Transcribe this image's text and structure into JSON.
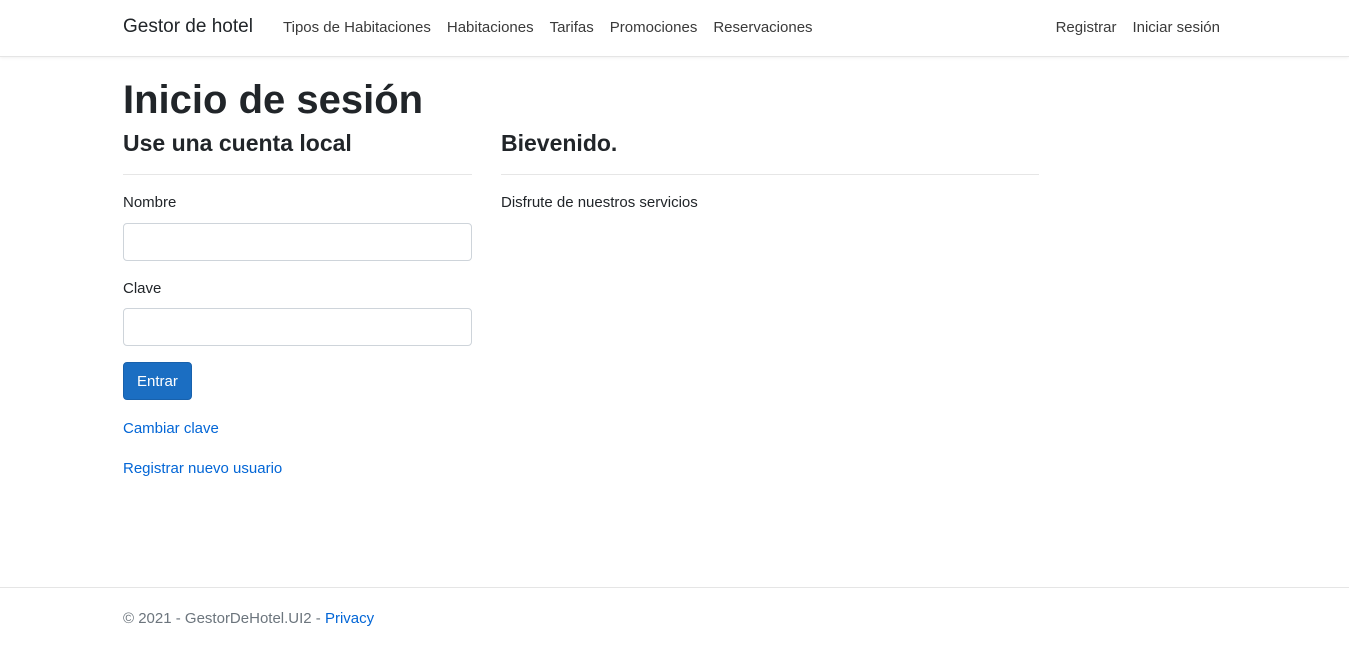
{
  "navbar": {
    "brand": "Gestor de hotel",
    "left_links": [
      "Tipos de Habitaciones",
      "Habitaciones",
      "Tarifas",
      "Promociones",
      "Reservaciones"
    ],
    "right_links": [
      "Registrar",
      "Iniciar sesión"
    ]
  },
  "page": {
    "title": "Inicio de sesión"
  },
  "login": {
    "heading": "Use una cuenta local",
    "name_label": "Nombre",
    "name_value": "",
    "password_label": "Clave",
    "password_value": "",
    "submit_label": "Entrar",
    "change_password_link": "Cambiar clave",
    "register_link": "Registrar nuevo usuario"
  },
  "welcome": {
    "heading": "Bievenido.",
    "text": "Disfrute de nuestros servicios"
  },
  "footer": {
    "copyright": "© 2021 - GestorDeHotel.UI2 - ",
    "privacy_link": "Privacy"
  },
  "colors": {
    "primary_button": "#1b6ec2",
    "link": "#0366d6"
  }
}
